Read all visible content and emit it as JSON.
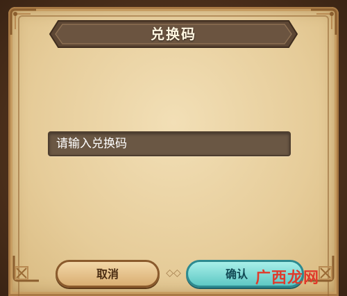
{
  "dialog": {
    "title": "兑换码"
  },
  "input": {
    "placeholder": "请输入兑换码",
    "value": ""
  },
  "buttons": {
    "cancel_label": "取消",
    "confirm_label": "确认"
  },
  "watermark": {
    "text": "广西龙网"
  },
  "colors": {
    "parchment": "#e6cc99",
    "banner": "#6b5440",
    "input_bg": "#6a5744",
    "cancel_button": "#d9ae72",
    "confirm_button": "#5ec8c4",
    "watermark_red": "#e03a2b"
  }
}
